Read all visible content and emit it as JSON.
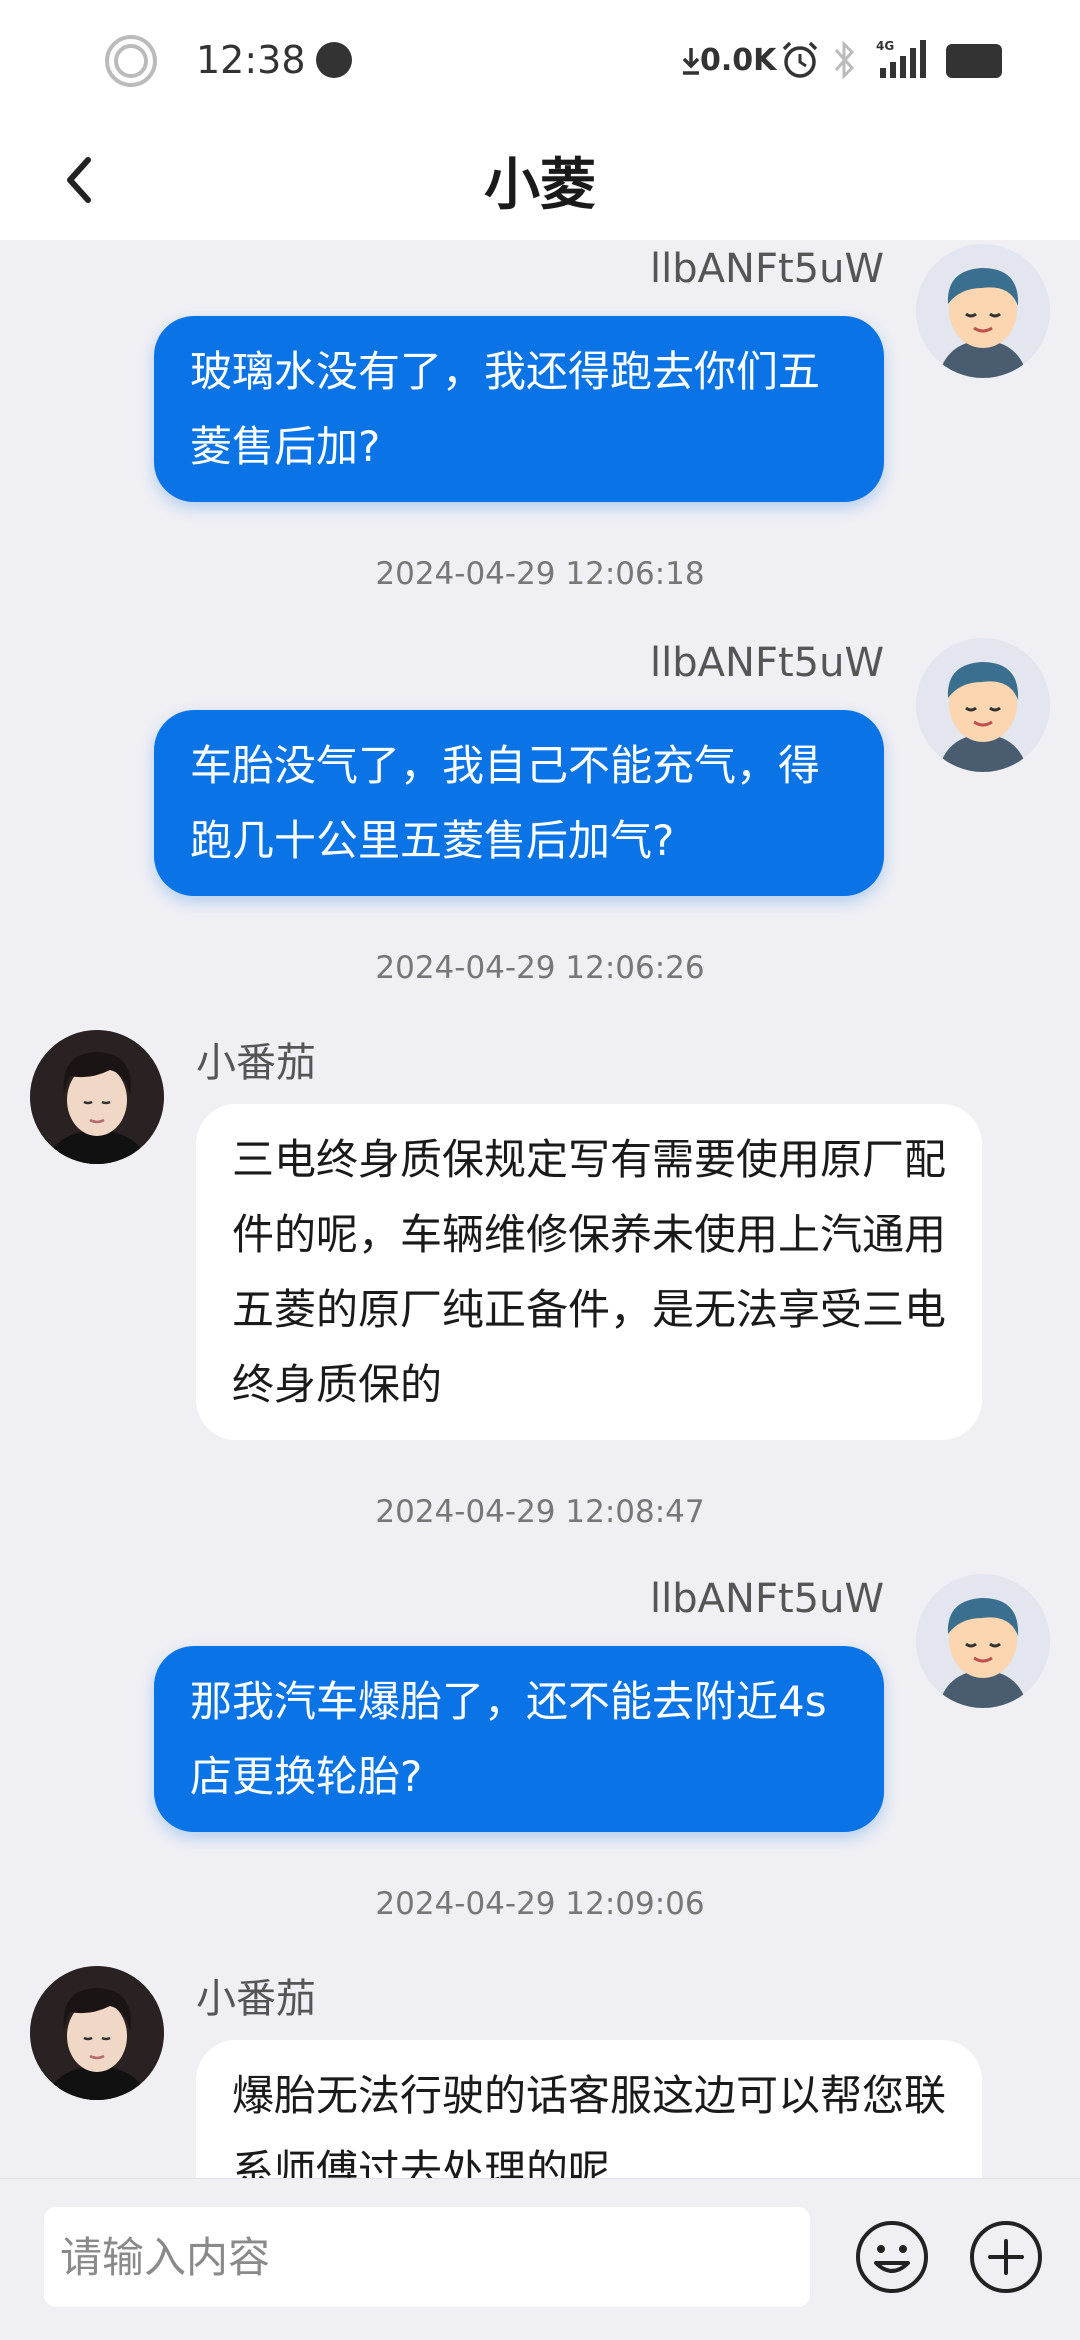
{
  "status_bar": {
    "time": "12:38",
    "notif_count": "2",
    "net_speed": "0.0K",
    "battery": "82"
  },
  "header": {
    "title": "小菱"
  },
  "messages": [
    {
      "sender": "llbANFt5uW",
      "text": "玻璃水没有了，我还得跑去你们五菱售后加?"
    },
    {
      "timestamp": "2024-04-29 12:06:18"
    },
    {
      "sender": "llbANFt5uW",
      "text": "车胎没气了，我自己不能充气，得跑几十公里五菱售后加气?"
    },
    {
      "timestamp": "2024-04-29 12:06:26"
    },
    {
      "sender": "小番茄",
      "text": "三电终身质保规定写有需要使用原厂配件的呢，车辆维修保养未使用上汽通用五菱的原厂纯正备件，是无法享受三电终身质保的"
    },
    {
      "timestamp": "2024-04-29 12:08:47"
    },
    {
      "sender": "llbANFt5uW",
      "text": "那我汽车爆胎了，还不能去附近4s店更换轮胎?"
    },
    {
      "timestamp": "2024-04-29 12:09:06"
    },
    {
      "sender": "小番茄",
      "text": "爆胎无法行驶的话客服这边可以帮您联系师傅过去处理的呢"
    }
  ],
  "input": {
    "placeholder": "请输入内容"
  }
}
